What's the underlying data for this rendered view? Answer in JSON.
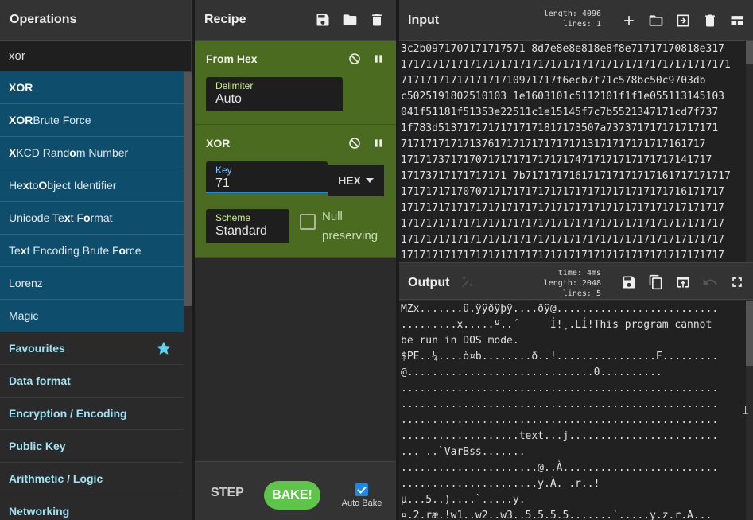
{
  "operations": {
    "title": "Operations",
    "search_value": "xor",
    "results": [
      {
        "pre": "",
        "hl": "X",
        "mid": "",
        "hl2": "OR",
        "post": ""
      },
      {
        "pre": "",
        "hl": "XOR",
        "mid": " Brute Force",
        "hl2": "",
        "post": ""
      },
      {
        "pre": "",
        "hl": "X",
        "mid": "KCD Rand",
        "hl2": "o",
        "post": "m Number"
      },
      {
        "pre": "He",
        "hl": "x",
        "mid": " to ",
        "hl2": "O",
        "post": "bject Identifier"
      },
      {
        "pre": "Unicode Te",
        "hl": "x",
        "mid": "t F",
        "hl2": "o",
        "post": "rmat"
      },
      {
        "pre": "Te",
        "hl": "x",
        "mid": "t Encoding Brute F",
        "hl2": "o",
        "post": "rce"
      },
      {
        "pre": "Lorenz",
        "hl": "",
        "mid": "",
        "hl2": "",
        "post": ""
      },
      {
        "pre": "Magic",
        "hl": "",
        "mid": "",
        "hl2": "",
        "post": ""
      }
    ],
    "categories": [
      "Favourites",
      "Data format",
      "Encryption / Encoding",
      "Public Key",
      "Arithmetic / Logic",
      "Networking"
    ]
  },
  "recipe": {
    "title": "Recipe",
    "from_hex": {
      "title": "From Hex",
      "delimiter_label": "Delimiter",
      "delimiter_value": "Auto"
    },
    "xor": {
      "title": "XOR",
      "key_label": "Key",
      "key_value": "71",
      "key_format": "HEX",
      "scheme_label": "Scheme",
      "scheme_value": "Standard",
      "null_label": "Null preserving"
    },
    "step_label": "STEP",
    "bake_label": "BAKE!",
    "autobake_label": "Auto Bake"
  },
  "input": {
    "title": "Input",
    "length_label": "length:",
    "length_value": "4096",
    "lines_label": "lines:",
    "lines_value": "1",
    "text": "3c2b0971707171717571 8d7e8e8e818e8f8e71717170818e317\n17171717171717171717171717171717171717171717171717171\n7171717171717171710971717f6ecb7f71c578bc50c9703db\nc5025191802510103 1e1603101c5112101f1f1e055113145103\n041f51181f51353e22511c1e15145f7c7b5521347171cd7f737\n1f783d51371717171717171817173507a737371717171717171\n7171717171713761717171717171713171717171717161717\n17171737171707171717171717174717171717171717141717\n17173717171717171 7b717171716171717171717161717171717\n1717171717070717171717171717171717171717171716171717\n1717171717171717171717171717171717171717171717171717\n1717171717171717171717171717171717171717171717171717\n1717171717171717171717171717171717171717171717171717\n1717171717171717171717171717171717171717171717171717"
  },
  "output": {
    "title": "Output",
    "time_label": "time:",
    "time_value": "4ms",
    "length_label": "length:",
    "length_value": "2048",
    "lines_label": "lines:",
    "lines_value": "5",
    "text": "MZx.......ü.ÿÿðÿþÿ....ðÿ@..........................\n.........x.....º..´     Í!¸.LÍ!This program cannot\nbe run in DOS mode.\n$PE..¼....ò¤b........ð..!................F.........\n@..............................0..........\n...................................................\n...................................................\n...................................................\n...................text...j........................\n... ..`VarBss.......\n......................@..À.........................\n......................y.À. .r..!\nµ...5..)....`.....y.\n¤.2.ræ.!w1..w2..w3..5.5.5.5.......`.....y.z.r.A..."
  }
}
